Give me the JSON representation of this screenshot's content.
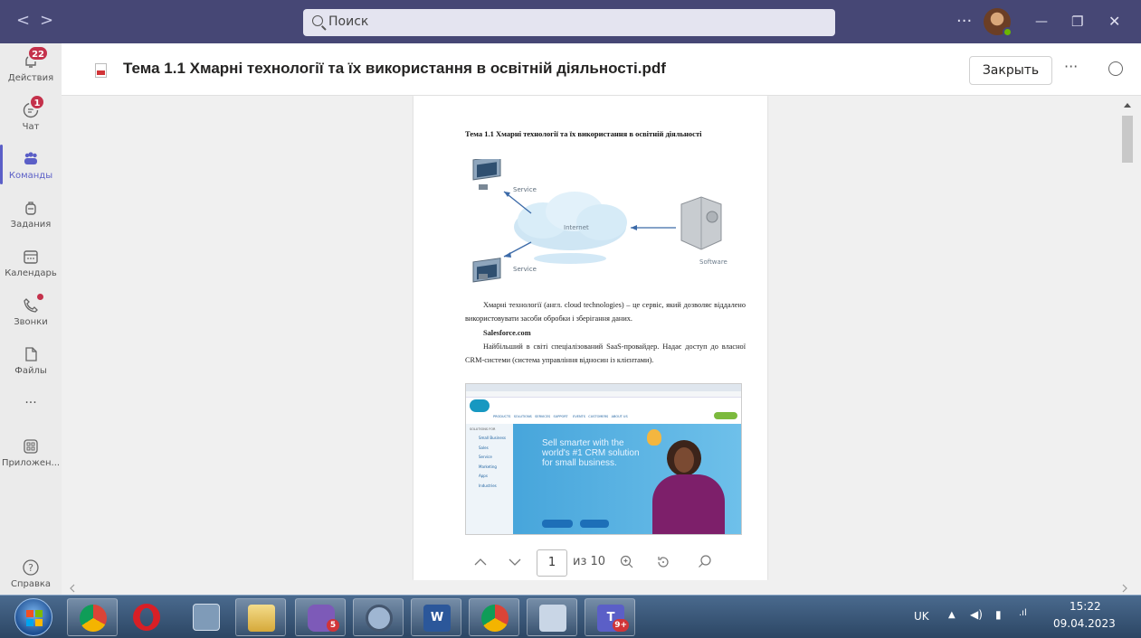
{
  "titlebar": {
    "back_glyph": "<",
    "forward_glyph": ">",
    "search_placeholder": "Поиск",
    "more_glyph": "···",
    "minimize_glyph": "—",
    "maximize_glyph": "❐",
    "close_glyph": "✕"
  },
  "rail": {
    "items": [
      {
        "label": "Действия",
        "icon": "bell-icon",
        "badge": "22"
      },
      {
        "label": "Чат",
        "icon": "chat-icon",
        "badge": "1"
      },
      {
        "label": "Команды",
        "icon": "teams-icon",
        "active": true
      },
      {
        "label": "Задания",
        "icon": "backpack-icon"
      },
      {
        "label": "Календарь",
        "icon": "calendar-icon"
      },
      {
        "label": "Звонки",
        "icon": "phone-icon",
        "dot": true
      },
      {
        "label": "Файлы",
        "icon": "file-icon"
      },
      {
        "label": "···",
        "icon": "more-icon"
      },
      {
        "label": "Приложен...",
        "icon": "apps-icon"
      },
      {
        "label": "Справка",
        "icon": "help-icon"
      }
    ]
  },
  "header": {
    "title": "Тема 1.1 Хмарні технології та їх використання в освітній діяльності.pdf",
    "close_label": "Закрыть",
    "more_glyph": "···"
  },
  "document": {
    "heading": "Тема 1.1 Хмарні технології та їх використання в освітній діяльності",
    "diagram": {
      "labels": [
        "Service",
        "Internet",
        "Service",
        "Software"
      ]
    },
    "para1": "Хмарні технології (англ. cloud technologies) – це сервіс, який дозволяє віддалено використовувати засоби обробки і зберігання даних.",
    "subheading": "Salesforce.com",
    "para2": "Найбільший в світі спеціалізований SaaS-провайдер. Надає доступ до власної CRM-системи (система управління відносин із клієнтами).",
    "screenshot": {
      "headline": "Sell smarter with the world's #1 CRM solution for small business.",
      "nav": [
        "PRODUCTS",
        "SOLUTIONS",
        "SERVICES",
        "SUPPORT",
        "EVENTS",
        "CUSTOMERS",
        "ABOUT US"
      ],
      "solutions_title": "SOLUTIONS FOR",
      "solutions": [
        "Small Business",
        "Sales",
        "Service",
        "Marketing",
        "Apps",
        "Industries"
      ]
    }
  },
  "pager": {
    "current_page": "1",
    "of_label": "из 10"
  },
  "taskbar": {
    "apps": [
      {
        "name": "chrome",
        "color": "#e8453c",
        "badge": ""
      },
      {
        "name": "opera",
        "color": "#d81f26",
        "badge": ""
      },
      {
        "name": "calculator",
        "color": "#7f9bb8",
        "badge": ""
      },
      {
        "name": "explorer",
        "color": "#e8c25a",
        "badge": ""
      },
      {
        "name": "viber",
        "color": "#7d5ab8",
        "badge": "5"
      },
      {
        "name": "magnifier",
        "color": "#9fb6d2",
        "badge": ""
      },
      {
        "name": "word",
        "color": "#2b579a",
        "badge": ""
      },
      {
        "name": "chrome-profile",
        "color": "#e8453c",
        "badge": ""
      },
      {
        "name": "snipping",
        "color": "#c9d6e6",
        "badge": ""
      },
      {
        "name": "teams",
        "color": "#5b5fc7",
        "badge": "9+"
      }
    ],
    "lang": "UK",
    "time": "15:22",
    "date": "09.04.2023"
  }
}
